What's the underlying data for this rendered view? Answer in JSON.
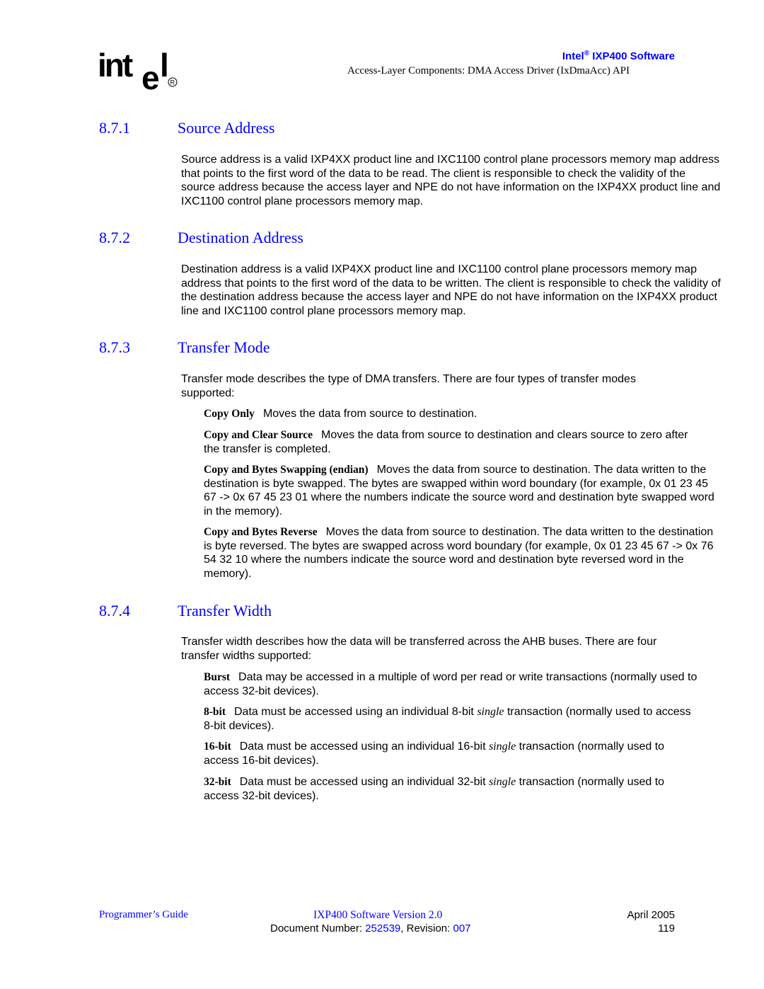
{
  "header": {
    "logo_text": "intel",
    "product_brand": "Intel",
    "product_registered": "®",
    "product_name": " IXP400 Software",
    "subtitle": "Access-Layer Components: DMA Access Driver (IxDmaAcc) API"
  },
  "sections": [
    {
      "number": "8.7.1",
      "title": "Source Address",
      "paragraph": "Source address is a valid IXP4XX product line and IXC1100 control plane processors memory map address that points to the first word of the data to be read. The client is responsible to check the validity of the source address because the access layer and NPE do not have information on the IXP4XX product line and IXC1100 control plane processors  memory map."
    },
    {
      "number": "8.7.2",
      "title": "Destination Address",
      "paragraph": "Destination address is a valid IXP4XX product line and IXC1100 control plane processors memory map address that points to the first word of the data to be written. The client is responsible to check the validity of the destination address because the access layer and NPE do not have information on the IXP4XX product line and IXC1100 control plane processors memory map."
    },
    {
      "number": "8.7.3",
      "title": "Transfer Mode",
      "paragraph": "Transfer mode describes the type of DMA transfers. There are four types of transfer modes supported:",
      "items": [
        {
          "term": "Copy Only",
          "description": "Moves the data from source to destination."
        },
        {
          "term": "Copy and Clear Source",
          "description": "Moves the data from source to destination and clears source to zero after the transfer is completed."
        },
        {
          "term": "Copy and Bytes Swapping (endian)",
          "description": "Moves the data from source to destination. The data written to the destination is byte swapped. The bytes are swapped within word boundary (for example, 0x 01 23 45 67 -> 0x 67 45 23 01 where the numbers indicate the source word and destination byte swapped word in the memory)."
        },
        {
          "term": "Copy and Bytes Reverse",
          "description": "Moves the data from source to destination. The data written to the destination is byte reversed. The bytes are swapped across word boundary (for example, 0x 01 23 45 67 -> 0x 76 54 32 10 where the numbers indicate the source word and destination byte reversed word in the memory)."
        }
      ]
    },
    {
      "number": "8.7.4",
      "title": "Transfer Width",
      "paragraph": "Transfer width describes how the data will be transferred across the AHB buses. There are four transfer widths supported:",
      "items": [
        {
          "term": "Burst",
          "description": "Data may be accessed in a multiple of word per read or write transactions (normally used to access 32-bit devices)."
        },
        {
          "term": "8-bit",
          "desc_pre": "Data must be accessed using an individual 8-bit ",
          "desc_ital": "single",
          "desc_post": " transaction (normally used to access 8-bit devices)."
        },
        {
          "term": "16-bit",
          "desc_pre": "Data must be accessed using an individual 16-bit ",
          "desc_ital": "single",
          "desc_post": " transaction (normally used to access 16-bit devices)."
        },
        {
          "term": "32-bit",
          "desc_pre": "Data must be accessed using an individual 32-bit ",
          "desc_ital": "single",
          "desc_post": " transaction (normally used to access 32-bit devices)."
        }
      ]
    }
  ],
  "footer": {
    "left": "Programmer’s Guide",
    "center": "IXP400 Software Version 2.0",
    "doc_label": "Document Number: ",
    "doc_number": "252539",
    "rev_label": ", Revision: ",
    "revision": "007",
    "date": "April 2005",
    "page": "119"
  },
  "colors": {
    "heading": "#0000ff",
    "text": "#000000"
  }
}
